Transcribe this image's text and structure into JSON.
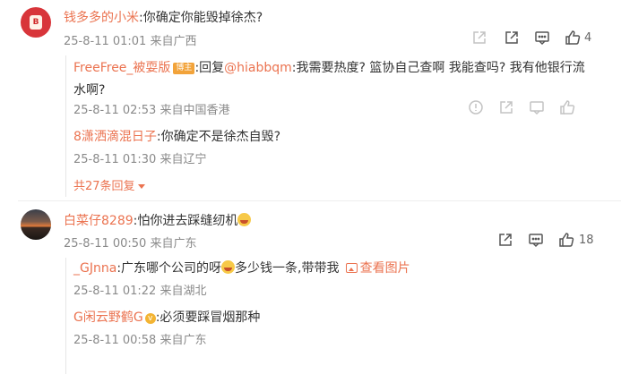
{
  "comments": [
    {
      "user": "钱多多的小米",
      "text": ":你确定你能毁掉徐杰?",
      "meta": "25-8-11 01:01 来自广西",
      "likes": "4",
      "replies": [
        {
          "user": "FreeFree_被耍版",
          "badge": "博主",
          "text_prefix": ":回复",
          "mention": "@hiabbqm",
          "text": ":我需要热度? 篮协自己查啊 我能查吗? 我有他银行流水啊?",
          "meta": "25-8-11 02:53 来自中国香港"
        },
        {
          "user": "8潇洒滴混日子",
          "text": ":你确定不是徐杰自毁?",
          "meta": "25-8-11 01:30 来自辽宁"
        }
      ],
      "more_replies": "共27条回复"
    },
    {
      "user": "白菜仔8289",
      "text": ":怕你进去踩缝纫机",
      "meta": "25-8-11 00:50 来自广东",
      "likes": "18",
      "replies": [
        {
          "user": "_GJnna",
          "text": ":广东哪个公司的呀",
          "text2": "多少钱一条,带带我",
          "view_pic": "查看图片",
          "meta": "25-8-11 01:22 来自湖北"
        },
        {
          "user": "G闲云野鹤G",
          "text": ":必须要踩冒烟那种",
          "meta": "25-8-11 00:58 来自广东"
        }
      ]
    }
  ],
  "colors": {
    "username": "#eb7350",
    "meta": "#8a8a8a",
    "text": "#333333",
    "badge": "#f2a33a"
  },
  "icons": [
    "share-icon",
    "comment-icon",
    "like-icon"
  ]
}
